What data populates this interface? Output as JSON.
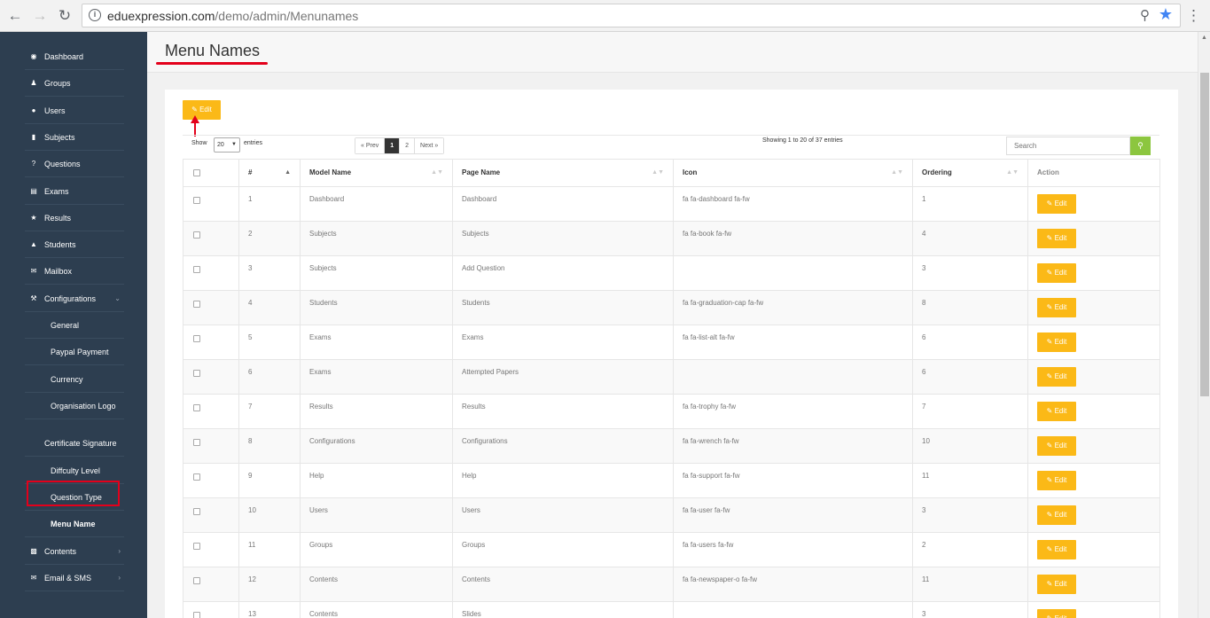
{
  "browser": {
    "url_host": "eduexpression.com",
    "url_path": "/demo/admin/Menunames"
  },
  "sidebar": {
    "items": [
      {
        "label": "Dashboard",
        "icon": "dashboard-icon"
      },
      {
        "label": "Groups",
        "icon": "users-icon"
      },
      {
        "label": "Users",
        "icon": "user-icon"
      },
      {
        "label": "Subjects",
        "icon": "book-icon"
      },
      {
        "label": "Questions",
        "icon": "question-icon"
      },
      {
        "label": "Exams",
        "icon": "list-icon"
      },
      {
        "label": "Results",
        "icon": "trophy-icon"
      },
      {
        "label": "Students",
        "icon": "graduation-cap-icon"
      },
      {
        "label": "Mailbox",
        "icon": "envelope-icon"
      },
      {
        "label": "Configurations",
        "icon": "wrench-icon"
      }
    ],
    "config_sub": [
      "General",
      "Paypal Payment",
      "Currency",
      "Organisation Logo",
      "Certificate Signature",
      "Diffculty Level",
      "Question Type",
      "Menu Name"
    ],
    "bottom_items": [
      {
        "label": "Contents",
        "icon": "newspaper-icon"
      },
      {
        "label": "Email & SMS",
        "icon": "envelope-icon"
      }
    ]
  },
  "page": {
    "title": "Menu Names",
    "edit_label": "Edit"
  },
  "table_controls": {
    "show_label": "Show",
    "page_size": "20",
    "entries_label": "entries",
    "prev": "« Prev",
    "pages": [
      "1",
      "2"
    ],
    "current_page": "1",
    "next": "Next »",
    "showing": "Showing 1 to 20 of 37 entries",
    "search_placeholder": "Search"
  },
  "table": {
    "columns": [
      "#",
      "Model Name",
      "Page Name",
      "Icon",
      "Ordering",
      "Action"
    ],
    "rows": [
      {
        "num": "1",
        "model": "Dashboard",
        "page": "Dashboard",
        "icon": "fa fa-dashboard fa-fw",
        "ordering": "1"
      },
      {
        "num": "2",
        "model": "Subjects",
        "page": "Subjects",
        "icon": "fa fa-book fa-fw",
        "ordering": "4"
      },
      {
        "num": "3",
        "model": "Subjects",
        "page": "Add Question",
        "icon": "",
        "ordering": "3"
      },
      {
        "num": "4",
        "model": "Students",
        "page": "Students",
        "icon": "fa fa-graduation-cap fa-fw",
        "ordering": "8"
      },
      {
        "num": "5",
        "model": "Exams",
        "page": "Exams",
        "icon": "fa fa-list-alt fa-fw",
        "ordering": "6"
      },
      {
        "num": "6",
        "model": "Exams",
        "page": "Attempted Papers",
        "icon": "",
        "ordering": "6"
      },
      {
        "num": "7",
        "model": "Results",
        "page": "Results",
        "icon": "fa fa-trophy fa-fw",
        "ordering": "7"
      },
      {
        "num": "8",
        "model": "Configurations",
        "page": "Configurations",
        "icon": "fa fa-wrench fa-fw",
        "ordering": "10"
      },
      {
        "num": "9",
        "model": "Help",
        "page": "Help",
        "icon": "fa fa-support fa-fw",
        "ordering": "11"
      },
      {
        "num": "10",
        "model": "Users",
        "page": "Users",
        "icon": "fa fa-user fa-fw",
        "ordering": "3"
      },
      {
        "num": "11",
        "model": "Groups",
        "page": "Groups",
        "icon": "fa fa-users fa-fw",
        "ordering": "2"
      },
      {
        "num": "12",
        "model": "Contents",
        "page": "Contents",
        "icon": "fa fa-newspaper-o fa-fw",
        "ordering": "11"
      },
      {
        "num": "13",
        "model": "Contents",
        "page": "Slides",
        "icon": "",
        "ordering": "3"
      }
    ]
  },
  "colors": {
    "sidebar_bg": "#2d3e50",
    "edit_button": "#fbb917",
    "search_button": "#8cc63f",
    "highlight_red": "#e3001b"
  }
}
